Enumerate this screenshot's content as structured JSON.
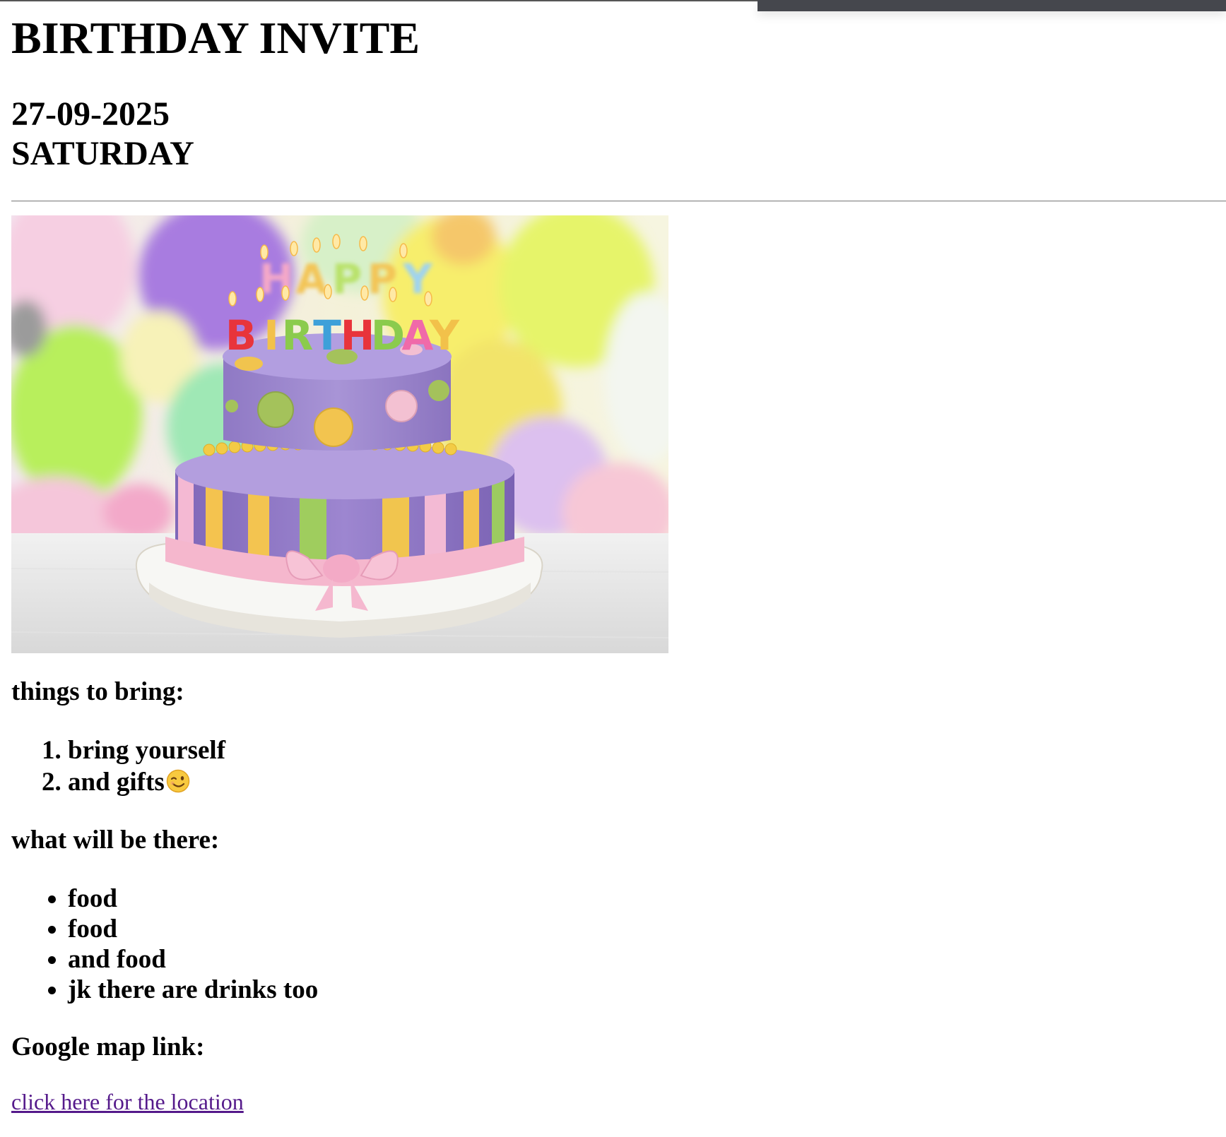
{
  "header": {
    "title": "BIRTHDAY INVITE",
    "date": "27-09-2025",
    "day": "SATURDAY"
  },
  "image": {
    "banner_text_line1": "HAPPY",
    "banner_text_line2": "BIRTHDAY"
  },
  "bring": {
    "heading": "things to bring:",
    "items": [
      "bring yourself",
      "and gifts"
    ],
    "emoji": "winking-face-icon"
  },
  "there": {
    "heading": "what will be there:",
    "items": [
      "food",
      "food",
      "and food",
      "jk there are drinks too"
    ]
  },
  "map": {
    "heading": "Google map link:",
    "link_text": "click here for the location"
  },
  "colors": {
    "text": "#000000",
    "visited_link": "#551a8b",
    "top_bar": "#45474d"
  }
}
